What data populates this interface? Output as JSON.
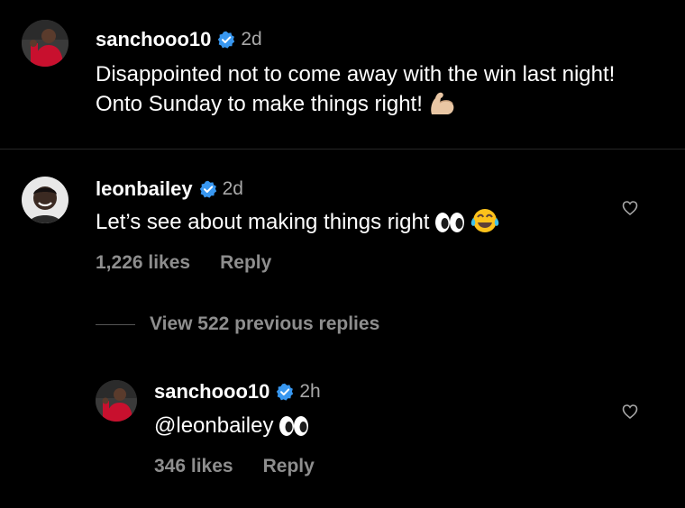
{
  "colors": {
    "background": "#000000",
    "text": "#ffffff",
    "muted": "#a8a8a8",
    "verified": "#3897f0",
    "divider": "#262626"
  },
  "post_caption": {
    "username": "sanchooo10",
    "verified": true,
    "time": "2d",
    "text": "Disappointed not to come away with the win last night! Onto Sunday to make things right!",
    "emoji": "flexed-biceps"
  },
  "comment": {
    "username": "leonbailey",
    "verified": true,
    "time": "2d",
    "text": "Let’s see about making things right",
    "emojis": [
      "eyes",
      "face-with-tears-of-joy"
    ],
    "likes": "1,226 likes",
    "reply_label": "Reply",
    "icon": "heart-outline-icon"
  },
  "view_replies": {
    "label": "View 522 previous replies"
  },
  "reply": {
    "username": "sanchooo10",
    "verified": true,
    "time": "2h",
    "text": "@leonbailey",
    "emojis": [
      "eyes"
    ],
    "likes": "346 likes",
    "reply_label": "Reply",
    "icon": "heart-outline-icon"
  }
}
